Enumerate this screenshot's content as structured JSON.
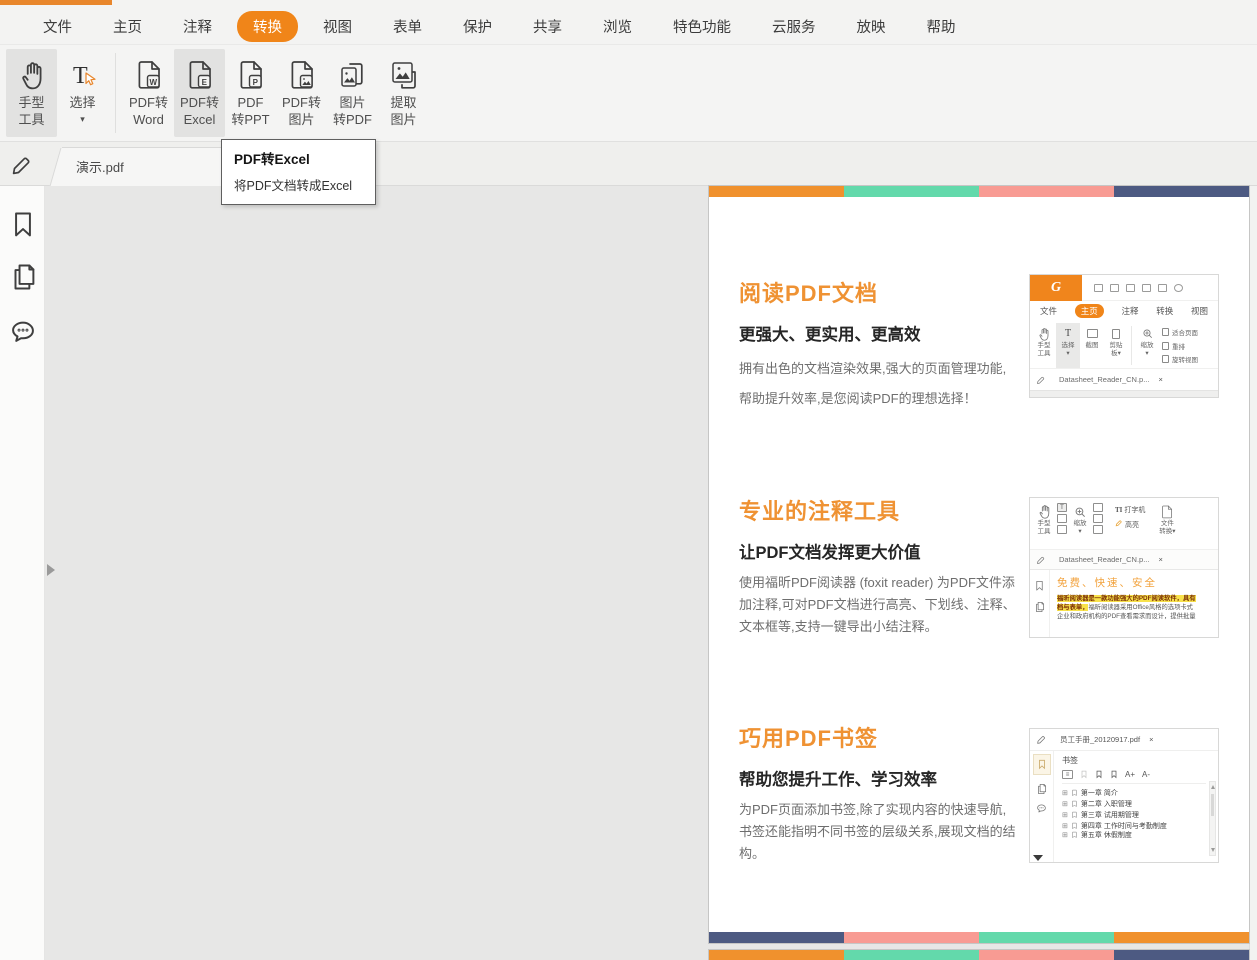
{
  "colors": {
    "accent": "#F08519",
    "page_strip_orange": "#F0912D",
    "page_strip_teal": "#63D9AB",
    "page_strip_salmon": "#F89B93",
    "page_strip_navy": "#4D5A82",
    "heading_orange": "#EF9233",
    "highlight_yellow": "#F8E24B"
  },
  "menu": {
    "items": [
      "文件",
      "主页",
      "注释",
      "转换",
      "视图",
      "表单",
      "保护",
      "共享",
      "浏览",
      "特色功能",
      "云服务",
      "放映",
      "帮助"
    ],
    "active": "转换"
  },
  "ribbon": {
    "buttons": [
      {
        "line1": "手型",
        "line2": "工具"
      },
      {
        "line1": "选择",
        "line2": "▾"
      },
      {
        "line1": "PDF转",
        "line2": "Word",
        "badge": "W"
      },
      {
        "line1": "PDF转",
        "line2": "Excel",
        "badge": "E"
      },
      {
        "line1": "PDF",
        "line2": "转PPT",
        "badge": "P"
      },
      {
        "line1": "PDF转",
        "line2": "图片"
      },
      {
        "line1": "图片",
        "line2": "转PDF"
      },
      {
        "line1": "提取",
        "line2": "图片"
      }
    ]
  },
  "tooltip": {
    "title": "PDF转Excel",
    "body": "将PDF文档转成Excel"
  },
  "tabbar": {
    "filename": "演示.pdf"
  },
  "doc": {
    "sections": [
      {
        "heading": "阅读PDF文档",
        "subheading": "更强大、更实用、更高效",
        "body": "拥有出色的文档渲染效果,强大的页面管理功能,帮助提升效率,是您阅读PDF的理想选择！"
      },
      {
        "heading": "专业的注释工具",
        "subheading": "让PDF文档发挥更大价值",
        "body": "使用福昕PDF阅读器 (foxit reader) 为PDF文件添加注释,可对PDF文档进行高亮、下划线、注释、文本框等,支持一键导出小结注释。"
      },
      {
        "heading": "巧用PDF书签",
        "subheading": "帮助您提升工作、学习效率",
        "body": "为PDF页面添加书签,除了实现内容的快速导航,书签还能指明不同书签的层级关系,展现文档的结构。"
      }
    ]
  },
  "thumb1": {
    "logo": "G",
    "menu": [
      "文件",
      "主页",
      "注释",
      "转换",
      "视图"
    ],
    "active_menu": "主页",
    "tools": [
      {
        "a": "手型",
        "b": "工具"
      },
      {
        "a": "选择",
        "b": "▾"
      },
      {
        "a": "截图",
        "b": ""
      },
      {
        "a": "剪贴",
        "b": "板▾"
      },
      {
        "a": "缩放",
        "b": "▾"
      }
    ],
    "view_options": [
      "适合页面",
      "重排",
      "旋转视图"
    ],
    "tab": "Datasheet_Reader_CN.p...",
    "close": "×"
  },
  "thumb2": {
    "hand_a": "手型",
    "hand_b": "工具",
    "zoom": "缩放",
    "typewriter_prefix": "TI",
    "typewriter": "打字机",
    "highlight": "高亮",
    "convert_a": "文件",
    "convert_b": "转换▾",
    "tab": "Datasheet_Reader_CN.p...",
    "close": "×",
    "heading": "免费、快速、安全",
    "hl1": "福昕阅读器是一款功能强大的PDF阅读软件，具有",
    "hl2": "档与表单，",
    "rest2": "福昕阅读器采用Office风格的选项卡式",
    "line3": "企业和政府机构的PDF查看需求而设计，提供批量"
  },
  "thumb3": {
    "tab": "员工手册_20120917.pdf",
    "close": "×",
    "panel_title": "书签",
    "font_plus": "A+",
    "font_minus": "A-",
    "expander": "⊞",
    "bookmarks": [
      "第一章 简介",
      "第二章 入职管理",
      "第三章 试用期管理",
      "第四章 工作时间与考勤制度",
      "第五章 休假制度"
    ]
  }
}
